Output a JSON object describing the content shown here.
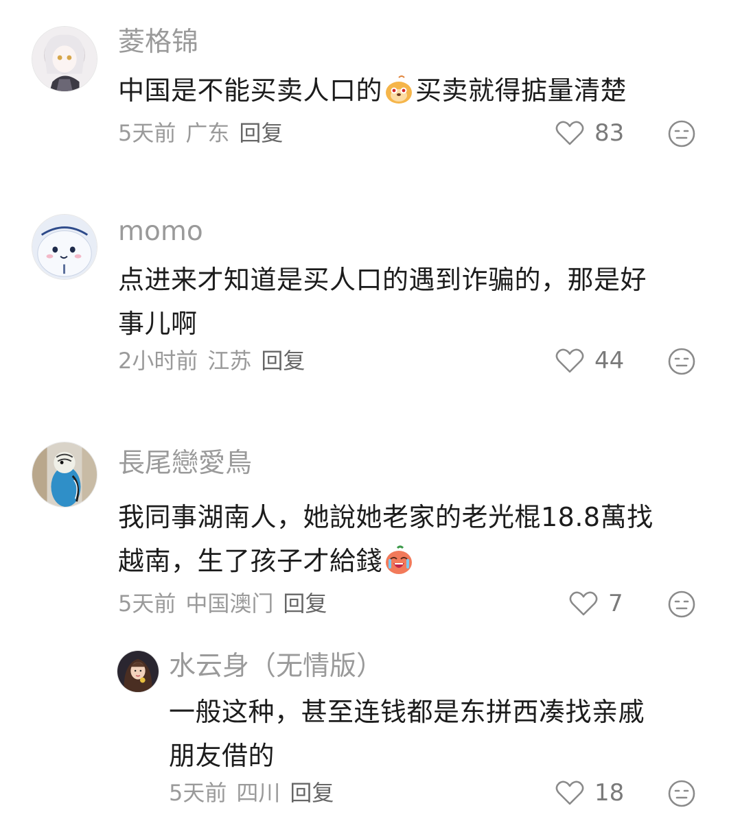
{
  "comments": [
    {
      "username": "菱格锦",
      "content_before_emoji": "中国是不能买卖人口的",
      "emoji": "doge-orange-emoji",
      "content_after_emoji": "买卖就得掂量清楚",
      "time": "5天前",
      "location": "广东",
      "reply_label": "回复",
      "likes": "83",
      "avatar": "anime-girl-avatar"
    },
    {
      "username": "momo",
      "content_line1": "点进来才知道是买人口的遇到诈骗的，那是好",
      "content_line2": "事儿啊",
      "time": "2小时前",
      "location": "江苏",
      "reply_label": "回复",
      "likes": "44",
      "avatar": "white-cartoon-avatar"
    },
    {
      "username": "長尾戀愛鳥",
      "content_line1": "我同事湖南人，她說她老家的老光棍18.8萬找",
      "content_line2": "越南，生了孩子才給錢",
      "emoji": "crying-orange-emoji",
      "time": "5天前",
      "location": "中国澳门",
      "reply_label": "回复",
      "likes": "7",
      "avatar": "budgie-bird-avatar"
    }
  ],
  "reply": {
    "username": "水云身（无情版）",
    "content_line1": "一般这种，甚至连钱都是东拼西凑找亲戚",
    "content_line2": "朋友借的",
    "time": "5天前",
    "location": "四川",
    "reply_label": "回复",
    "likes": "18",
    "avatar": "woman-portrait-avatar"
  },
  "colors": {
    "username": "#9a9a9a",
    "content": "#1c1c1c",
    "meta": "#9a9a9a",
    "icon": "#8a8a8a"
  }
}
